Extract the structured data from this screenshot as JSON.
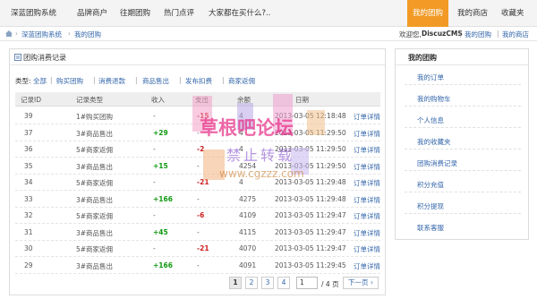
{
  "topnav": {
    "items": [
      "深蓝团购系统",
      "品牌商户",
      "往期团购",
      "热门点评",
      "大家都在买什么?.."
    ],
    "active": "我的团购",
    "right": [
      "我的商店",
      "收藏夹"
    ]
  },
  "breadcrumb": {
    "items": [
      "深蓝团购系统",
      "我的团购"
    ],
    "welcome_prefix": "欢迎您,",
    "username": "DiscuzCMS",
    "links": [
      "我的团购",
      "我的商店"
    ]
  },
  "panel": {
    "title": "团购消费记录",
    "filter_label": "类型:",
    "filters": [
      "全部",
      "购买团购",
      "消费退款",
      "商品售出",
      "发布扣费",
      "商家返佣"
    ]
  },
  "table": {
    "headers": [
      "记录ID",
      "记录类型",
      "收入",
      "支出",
      "余额",
      "日期"
    ],
    "rows": [
      {
        "id": "39",
        "type": "1#购买团购",
        "income": "-",
        "expense": "-15",
        "balance": "4",
        "date": "2013-03-05 12:18:48",
        "action": "订单详情"
      },
      {
        "id": "37",
        "type": "3#商品售出",
        "income": "+29",
        "expense": "-",
        "balance": "4",
        "date": "2013-03-05 11:29:50",
        "action": "订单详情"
      },
      {
        "id": "36",
        "type": "5#商家返佣",
        "income": "-",
        "expense": "-2",
        "balance": "4",
        "date": "2013-03-05 11:29:50",
        "action": "订单详情"
      },
      {
        "id": "35",
        "type": "3#商品售出",
        "income": "+15",
        "expense": "-",
        "balance": "4254",
        "date": "2013-03-05 11:29:50",
        "action": "订单详情"
      },
      {
        "id": "34",
        "type": "5#商家返佣",
        "income": "-",
        "expense": "-21",
        "balance": "4",
        "date": "2013-03-05 11:29:48",
        "action": "订单详情"
      },
      {
        "id": "33",
        "type": "3#商品售出",
        "income": "+166",
        "expense": "-",
        "balance": "4275",
        "date": "2013-03-05 11:29:48",
        "action": "订单详情"
      },
      {
        "id": "32",
        "type": "5#商家返佣",
        "income": "-",
        "expense": "-6",
        "balance": "4109",
        "date": "2013-03-05 11:29:47",
        "action": "订单详情"
      },
      {
        "id": "31",
        "type": "3#商品售出",
        "income": "+45",
        "expense": "-",
        "balance": "4115",
        "date": "2013-03-05 11:29:47",
        "action": "订单详情"
      },
      {
        "id": "30",
        "type": "5#商家返佣",
        "income": "-",
        "expense": "-21",
        "balance": "4070",
        "date": "2013-03-05 11:29:47",
        "action": "订单详情"
      },
      {
        "id": "29",
        "type": "3#商品售出",
        "income": "+166",
        "expense": "-",
        "balance": "4091",
        "date": "2013-03-05 11:29:45",
        "action": "订单详情"
      }
    ]
  },
  "pagination": {
    "pages": [
      "1",
      "2",
      "3",
      "4"
    ],
    "current": "1",
    "input_value": "1",
    "total_text": "/ 4 页",
    "next": "下一页"
  },
  "sidebar": {
    "title": "我的团购",
    "items": [
      "我的订单",
      "我的购物车",
      "个人信息",
      "我的收藏夹",
      "团购消费记录",
      "积分充值",
      "积分提现",
      "联系客服"
    ]
  },
  "watermark": {
    "line1": "草根吧论坛",
    "line2": "禁止转载",
    "line3": "www.cgzzz.com"
  },
  "colors": {
    "accent": "#f29a25",
    "link": "#3366aa",
    "income": "#119911",
    "expense": "#cc2222"
  }
}
